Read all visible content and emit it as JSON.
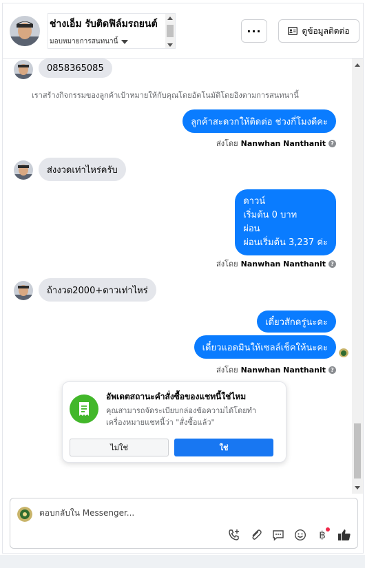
{
  "header": {
    "contact_name": "ช่างเอ็ม รับติดฟิล์มรถยนต์",
    "assign_label": "มอบหมายการสนทนานี้",
    "more_label": "···",
    "view_contact_label": "ดูข้อมูลติดต่อ"
  },
  "messages": {
    "in_phone": "0858365085",
    "system_note": "เราสร้างกิจกรรมของลูกค้าเป้าหมายให้กับคุณโดยอัตโนมัติโดยอิงตามการสนทนานี้",
    "out_1": "ลูกค้าสะดวกให้ติดต่อ ช่วงกี่โมงดีคะ",
    "sent_by_prefix": "ส่งโดย",
    "sender_name": "Nanwhan Nanthanit",
    "in_2": "ส่งงวดเท่าไหร่ครับ",
    "out_2_lines": [
      "ดาวน์",
      "เริ่มต้น 0 บาท",
      "ผ่อน",
      "ผ่อนเริ่มต้น 3,237 ค่ะ"
    ],
    "in_3": "ถ้างวด2000+ดาวเท่าไหร่",
    "out_3": "เดี๋ยวสักครู่นะคะ",
    "out_4": "เดี๋ยวแอดมินให้เซลล์เช็คให้นะคะ"
  },
  "card": {
    "title": "อัพเดตสถานะคำสั่งซื้อของแชทนี้ใช่ไหม",
    "body": "คุณสามารถจัดระเบียบกล่องข้อความได้โดยทำเครื่องหมายแชทนี้ว่า \"สั่งซื้อแล้ว\"",
    "no_label": "ไม่ใช่",
    "yes_label": "ใช่"
  },
  "composer": {
    "placeholder": "ตอบกลับใน Messenger..."
  },
  "icons": {
    "call": "phone-plus-icon",
    "attach": "paperclip-icon",
    "saved_reply": "chat-bubble-icon",
    "emoji": "smiley-icon",
    "payment": "baht-icon",
    "like": "thumbs-up-icon"
  },
  "colors": {
    "accent": "#0a7cff",
    "button_primary": "#1877f2",
    "success": "#42b72a",
    "incoming_bubble": "#e4e6eb"
  }
}
